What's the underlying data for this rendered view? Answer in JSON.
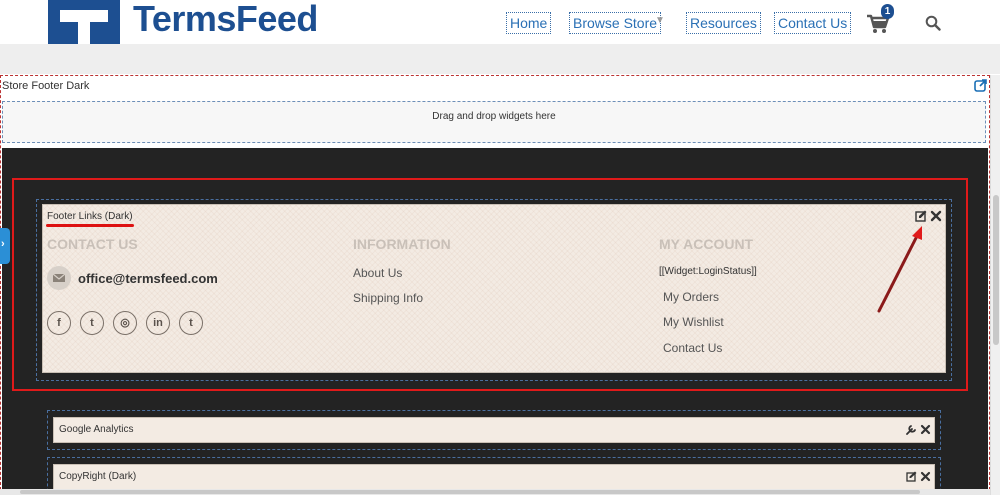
{
  "header": {
    "logo_text": "TermsFeed",
    "nav": [
      {
        "label": "Home"
      },
      {
        "label": "Browse Store"
      },
      {
        "label": "Resources"
      },
      {
        "label": "Contact Us"
      }
    ],
    "cart_count": "1",
    "brand_color": "#1d4f91"
  },
  "store_footer": {
    "title": "Store Footer Dark",
    "dropzone_text": "Drag and drop widgets here"
  },
  "footer_links_widget": {
    "title": "Footer Links (Dark)",
    "contact": {
      "heading": "CONTACT US",
      "email": "office@termsfeed.com",
      "social_icons": [
        "facebook-icon",
        "twitter-icon",
        "instagram-icon",
        "linkedin-icon",
        "tumblr-icon"
      ],
      "social_glyphs": [
        "f",
        "t",
        "◎",
        "in",
        "t"
      ]
    },
    "information": {
      "heading": "INFORMATION",
      "links": [
        "About Us",
        "Shipping Info"
      ]
    },
    "my_account": {
      "heading": "MY ACCOUNT",
      "login_status": "[[Widget:LoginStatus]]",
      "links": [
        "My Orders",
        "My Wishlist",
        "Contact Us"
      ]
    }
  },
  "bottom_widgets": [
    {
      "title": "Google Analytics"
    },
    {
      "title": "CopyRight (Dark)"
    }
  ],
  "colors": {
    "highlight_red": "#e01a1a",
    "arrow_color": "#8b1a1a",
    "dark_bg": "#232323",
    "panel_bg": "#f3ebe3"
  }
}
